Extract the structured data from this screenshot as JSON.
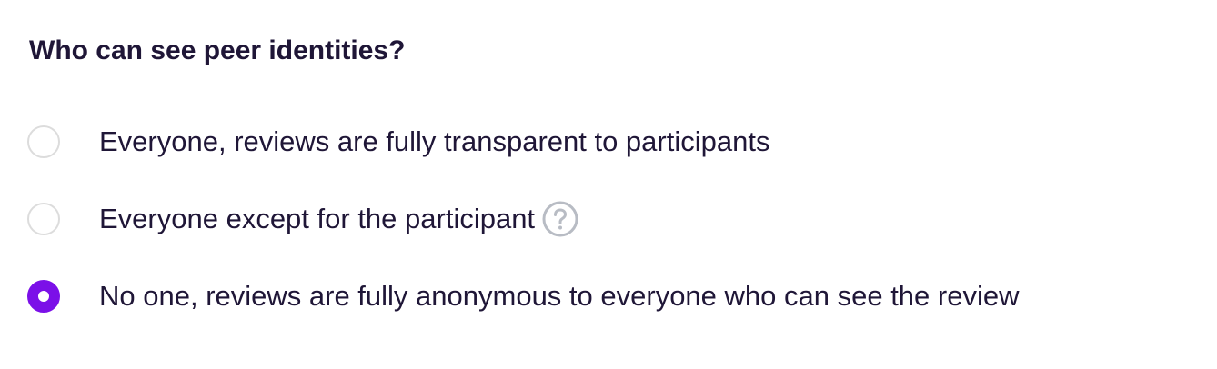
{
  "question": "Who can see peer identities?",
  "options": [
    {
      "label": "Everyone, reviews are fully transparent to participants",
      "checked": false
    },
    {
      "label": "Everyone except for the participant",
      "checked": false,
      "help_icon": "question-circle-icon"
    },
    {
      "label": "No one, reviews are fully anonymous to everyone who can see the review",
      "checked": true
    }
  ],
  "colors": {
    "accent": "#7B10E8",
    "text": "#1F1637",
    "radio_border": "#DCDCDC",
    "help_icon": "#B8BCC4"
  }
}
